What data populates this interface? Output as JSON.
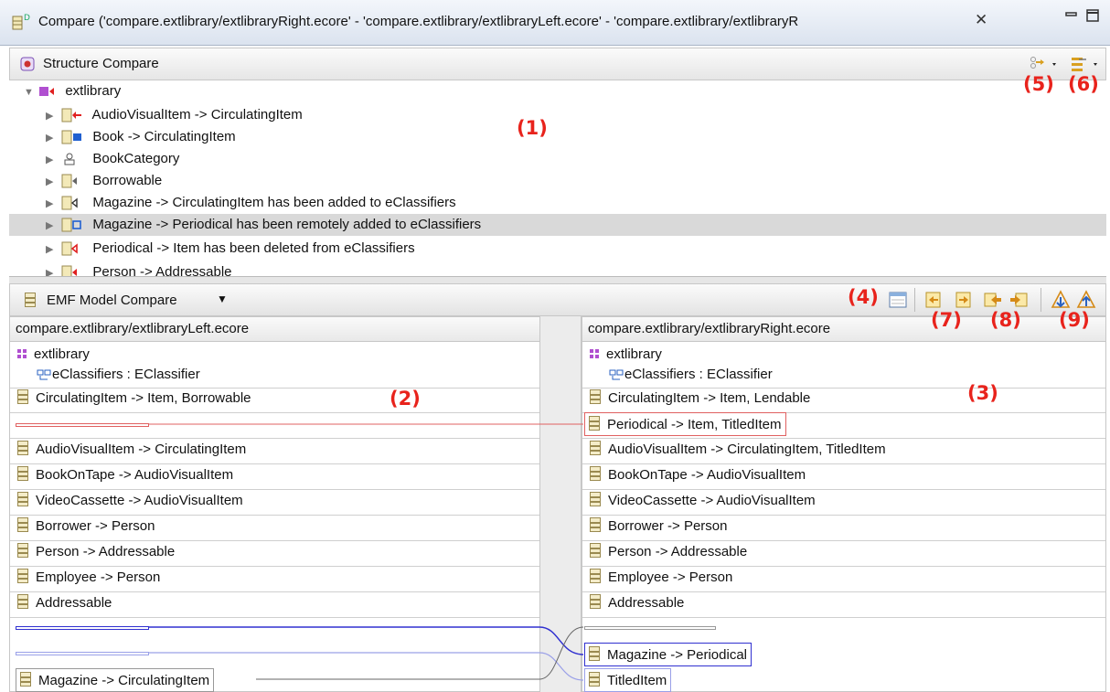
{
  "window": {
    "title": "Compare ('compare.extlibrary/extlibraryRight.ecore' - 'compare.extlibrary/extlibraryLeft.ecore' - 'compare.extlibrary/extlibraryR",
    "close_glyph": "✕"
  },
  "structure": {
    "header_label": "Structure Compare",
    "tree_root": "extlibrary",
    "items": [
      {
        "label": "AudioVisualItem -> CirculatingItem",
        "icon": "class-red-arrow-icon",
        "color": "#e02020"
      },
      {
        "label": "Book -> CirculatingItem",
        "icon": "class-blue-arrow-icon",
        "color": "#2060d0"
      },
      {
        "label": "BookCategory",
        "icon": "enum-icon",
        "color": "#555555"
      },
      {
        "label": "Borrowable",
        "icon": "class-gray-arrow-icon",
        "color": "#555555"
      },
      {
        "label": "Magazine -> CirculatingItem has been added to eClassifiers",
        "icon": "class-outline-arrow-icon",
        "color": "#333333"
      },
      {
        "label": "Magazine -> Periodical has been remotely added to eClassifiers",
        "icon": "class-blue-outline-arrow-icon",
        "color": "#2060d0"
      },
      {
        "label": "Periodical -> Item has been deleted from eClassifiers",
        "icon": "class-red-outline-arrow-icon",
        "color": "#e02020"
      },
      {
        "label": "Person -> Addressable",
        "icon": "class-red-arrow-icon",
        "color": "#e02020"
      }
    ]
  },
  "emf": {
    "header_label": "EMF Model Compare",
    "dropdown_glyph": "▼"
  },
  "left": {
    "header": "compare.extlibrary/extlibraryLeft.ecore",
    "root": "extlibrary",
    "feature": "eClassifiers : EClassifier",
    "rows": [
      "CirculatingItem -> Item, Borrowable",
      "AudioVisualItem -> CirculatingItem",
      "BookOnTape -> AudioVisualItem",
      "VideoCassette -> AudioVisualItem",
      "Borrower -> Person",
      "Person -> Addressable",
      "Employee -> Person",
      "Addressable"
    ],
    "bottom": "Magazine -> CirculatingItem"
  },
  "right": {
    "header": "compare.extlibrary/extlibraryRight.ecore",
    "root": "extlibrary",
    "feature": "eClassifiers : EClassifier",
    "rows": [
      "CirculatingItem -> Item, Lendable",
      "Periodical -> Item, TitledItem",
      "AudioVisualItem -> CirculatingItem, TitledItem",
      "BookOnTape -> AudioVisualItem",
      "VideoCassette -> AudioVisualItem",
      "Borrower -> Person",
      "Person -> Addressable",
      "Employee -> Person",
      "Addressable"
    ],
    "added1": "Magazine -> Periodical",
    "added2": "TitledItem"
  },
  "annotations": {
    "a1": "(1)",
    "a2": "(2)",
    "a3": "(3)",
    "a4": "(4)",
    "a5": "(5)",
    "a6": "(6)",
    "a7": "(7)",
    "a8": "(8)",
    "a9": "(9)"
  },
  "colors": {
    "annotation": "#e8231c",
    "deleted": "#e06060",
    "remote": "#3030d0",
    "selection": "#d9d9d9"
  }
}
